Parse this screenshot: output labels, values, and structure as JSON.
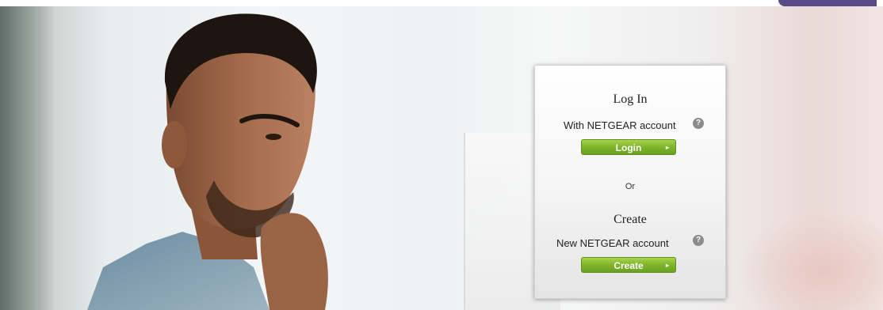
{
  "login_panel": {
    "login_heading": "Log In",
    "login_subtitle": "With NETGEAR account",
    "login_button": "Login",
    "or_text": "Or",
    "create_heading": "Create",
    "create_subtitle": "New NETGEAR account",
    "create_button": "Create",
    "help_glyph": "?",
    "arrow_glyph": "▸"
  },
  "icons": {
    "help": "help-icon",
    "arrow": "arrow-right-icon"
  },
  "colors": {
    "button_green": "#7fb52c",
    "corner_tab": "#5b4a86"
  }
}
